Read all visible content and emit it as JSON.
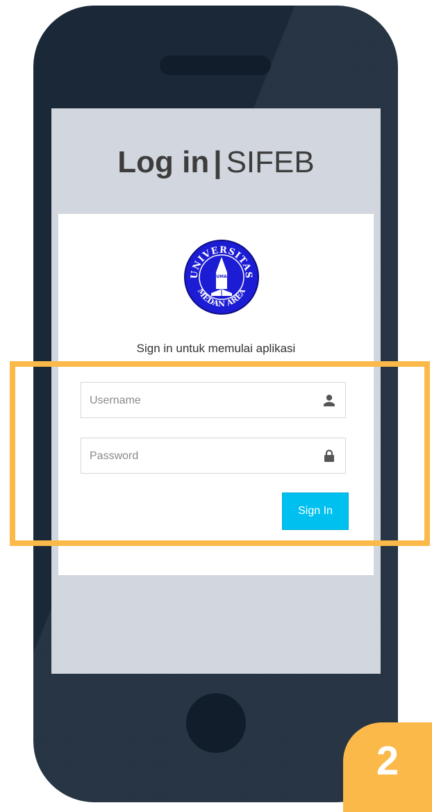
{
  "login": {
    "title_bold": "Log in",
    "separator": "|",
    "title_brand": "SIFEB",
    "logo_top_text": "UNIVERSITAS",
    "logo_bottom_text": "MEDAN AREA",
    "logo_mid_text": "UMA",
    "message": "Sign in untuk memulai aplikasi",
    "username_placeholder": "Username",
    "password_placeholder": "Password",
    "signin_label": "Sign In"
  },
  "step_badge": "2",
  "colors": {
    "phone_body": "#1a2838",
    "screen_bg": "#d2d6de",
    "highlight": "#fbb94a",
    "signin_button": "#00c0ef",
    "logo_blue": "#1c1cd4"
  }
}
